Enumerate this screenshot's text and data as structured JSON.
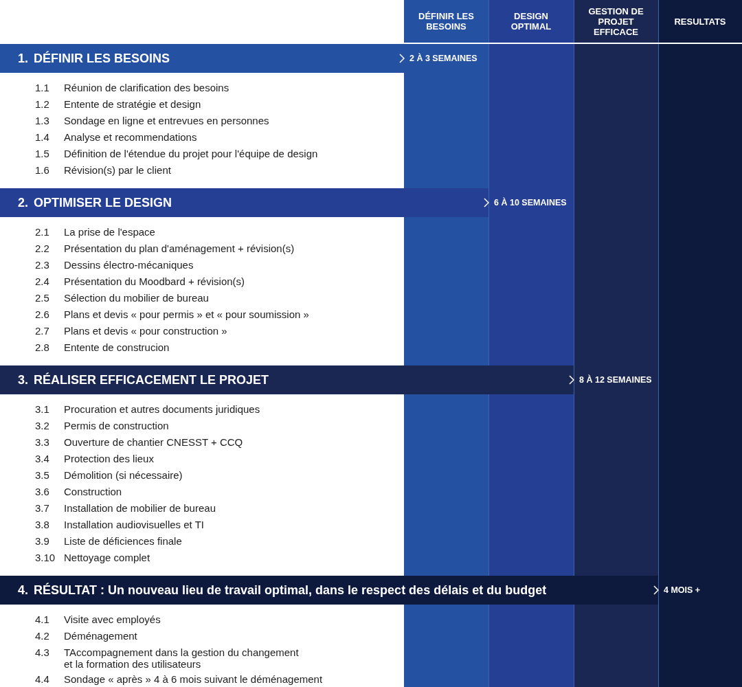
{
  "columns": [
    {
      "label": "DÉFINIR LES BESOINS",
      "color": "#2451a1"
    },
    {
      "label": "DESIGN OPTIMAL",
      "color": "#243f93"
    },
    {
      "label": "GESTION DE PROJET EFFICACE",
      "color": "#1b2753"
    },
    {
      "label": "RESULTATS",
      "color": "#0d1a3d"
    }
  ],
  "phases": [
    {
      "number": "1.",
      "title": "DÉFINIR LES BESOINS",
      "duration": "2 À 3 SEMAINES",
      "items": [
        {
          "number": "1.1",
          "text": "Réunion de clarification des besoins"
        },
        {
          "number": "1.2",
          "text": "Entente de stratégie et design"
        },
        {
          "number": "1.3",
          "text": "Sondage en ligne et entrevues en personnes"
        },
        {
          "number": "1.4",
          "text": "Analyse et recommendations"
        },
        {
          "number": "1.5",
          "text": "Définition de l'étendue du projet pour l'équipe de design"
        },
        {
          "number": "1.6",
          "text": "Révision(s) par le client"
        }
      ]
    },
    {
      "number": "2.",
      "title": "OPTIMISER LE DESIGN",
      "duration": "6 À 10 SEMAINES",
      "items": [
        {
          "number": "2.1",
          "text": "La prise de l'espace"
        },
        {
          "number": "2.2",
          "text": "Présentation du plan d'aménagement + révision(s)"
        },
        {
          "number": "2.3",
          "text": "Dessins électro-mécaniques"
        },
        {
          "number": "2.4",
          "text": "Présentation du Moodbard + révision(s)"
        },
        {
          "number": "2.5",
          "text": "Sélection du mobilier de bureau"
        },
        {
          "number": "2.6",
          "text": "Plans et devis « pour permis » et « pour soumission »"
        },
        {
          "number": "2.7",
          "text": "Plans et devis « pour construction »"
        },
        {
          "number": "2.8",
          "text": "Entente de construcion"
        }
      ]
    },
    {
      "number": "3.",
      "title": "RÉALISER EFFICACEMENT LE PROJET",
      "duration": "8 À 12 SEMAINES",
      "items": [
        {
          "number": "3.1",
          "text": "Procuration et autres documents juridiques"
        },
        {
          "number": "3.2",
          "text": "Permis de construction"
        },
        {
          "number": "3.3",
          "text": "Ouverture de chantier CNESST + CCQ"
        },
        {
          "number": "3.4",
          "text": "Protection des lieux"
        },
        {
          "number": "3.5",
          "text": "Démolition (si nécessaire)"
        },
        {
          "number": "3.6",
          "text": "Construction"
        },
        {
          "number": "3.7",
          "text": "Installation de mobilier de bureau"
        },
        {
          "number": "3.8",
          "text": "Installation audiovisuelles et TI"
        },
        {
          "number": "3.9",
          "text": "Liste de déficiences finale"
        },
        {
          "number": "3.10",
          "text": "Nettoyage complet"
        }
      ]
    },
    {
      "number": "4.",
      "title": "RÉSULTAT : Un nouveau lieu de travail optimal, dans le respect des délais et du budget",
      "duration": "4 MOIS +",
      "items": [
        {
          "number": "4.1",
          "text": "Visite avec employés"
        },
        {
          "number": "4.2",
          "text": "Déménagement"
        },
        {
          "number": "4.3",
          "text": "TAccompagnement dans la gestion du changement\net la formation des utilisateurs"
        },
        {
          "number": "4.4",
          "text": "Sondage « après » 4 à 6 mois suivant le déménagement"
        }
      ]
    }
  ]
}
